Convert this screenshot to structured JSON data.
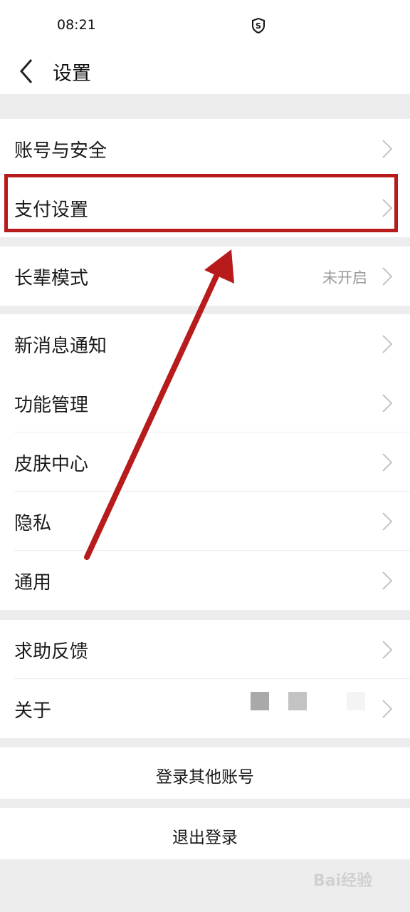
{
  "status": {
    "time": "08:21"
  },
  "header": {
    "title": "设置"
  },
  "groups": [
    {
      "items": [
        {
          "label": "账号与安全"
        },
        {
          "label": "支付设置"
        }
      ]
    },
    {
      "items": [
        {
          "label": "长辈模式",
          "value": "未开启"
        }
      ]
    },
    {
      "items": [
        {
          "label": "新消息通知"
        },
        {
          "label": "功能管理"
        },
        {
          "label": "皮肤中心"
        },
        {
          "label": "隐私"
        },
        {
          "label": "通用"
        }
      ]
    },
    {
      "items": [
        {
          "label": "求助反馈"
        },
        {
          "label": "关于"
        }
      ]
    }
  ],
  "buttons": {
    "switch_account": "登录其他账号",
    "logout": "退出登录"
  },
  "colors": {
    "highlight": "#b81b1b",
    "background": "#ededed"
  },
  "watermark": "Bai经验"
}
